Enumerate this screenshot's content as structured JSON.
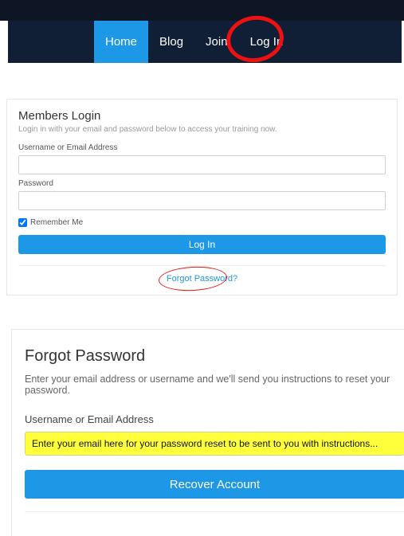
{
  "nav": {
    "items": [
      {
        "label": "Home",
        "active": true
      },
      {
        "label": "Blog",
        "active": false
      },
      {
        "label": "Join",
        "active": false
      },
      {
        "label": "Log In",
        "active": false
      }
    ]
  },
  "login": {
    "title": "Members Login",
    "subtitle": "Login in with your email and password below to access your training now.",
    "username_label": "Username or Email Address",
    "password_label": "Password",
    "remember_label": "Remember Me",
    "remember_checked": true,
    "submit_label": "Log In",
    "forgot_label": "Forgot Password?"
  },
  "forgot": {
    "title": "Forgot Password",
    "description": "Enter your email address or username and we'll send you instructions to reset your password.",
    "username_label": "Username or Email Address",
    "input_value": "Enter your email here for your password reset to be sent to you with instructions...",
    "submit_label": "Recover Account"
  },
  "colors": {
    "accent": "#1c98e7",
    "navbar": "#101e36",
    "highlight": "#ffff3b",
    "annotation": "#e11"
  }
}
